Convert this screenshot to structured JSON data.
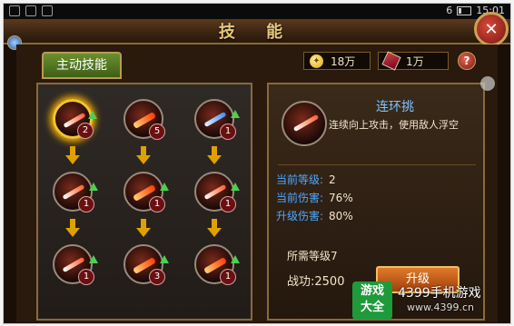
{
  "status_bar": {
    "battery": "6",
    "time": "15:01"
  },
  "window": {
    "title": "技 能",
    "close_label": "✕"
  },
  "tabs": [
    {
      "label": "主动技能"
    }
  ],
  "currencies": [
    {
      "icon": "coin-icon",
      "glyph": "✦",
      "value": "18万"
    },
    {
      "icon": "scroll-icon",
      "value": "1万"
    }
  ],
  "help_label": "?",
  "skills": [
    {
      "level": "2",
      "upgradable": true,
      "selected": true,
      "style": "slash"
    },
    {
      "level": "5",
      "upgradable": false,
      "selected": false,
      "style": "fire"
    },
    {
      "level": "1",
      "upgradable": true,
      "selected": false,
      "style": "blue"
    },
    {
      "level": "1",
      "upgradable": true,
      "selected": false,
      "style": "slash"
    },
    {
      "level": "1",
      "upgradable": true,
      "selected": false,
      "style": "fire"
    },
    {
      "level": "1",
      "upgradable": true,
      "selected": false,
      "style": "slash"
    },
    {
      "level": "1",
      "upgradable": true,
      "selected": false,
      "style": "slash"
    },
    {
      "level": "3",
      "upgradable": true,
      "selected": false,
      "style": "fire"
    },
    {
      "level": "1",
      "upgradable": true,
      "selected": false,
      "style": "fire"
    }
  ],
  "detail": {
    "name": "连环挑",
    "description": "连续向上攻击，使用敌人浮空",
    "stats": [
      {
        "label": "当前等级:",
        "value": "2"
      },
      {
        "label": "当前伤害:",
        "value": "76%"
      },
      {
        "label": "升级伤害:",
        "value": "80%"
      }
    ],
    "required": "所需等级7",
    "combat_power": "战功:2500",
    "upgrade_label": "升级"
  },
  "watermark": {
    "badge_line1": "游戏",
    "badge_line2": "大全",
    "title": "4399手机游戏",
    "url": "www.4399.cn"
  },
  "colors": {
    "accent_gold": "#c9a455",
    "name_blue": "#7fc3ff",
    "upgrade_orange": "#e07a2a"
  }
}
